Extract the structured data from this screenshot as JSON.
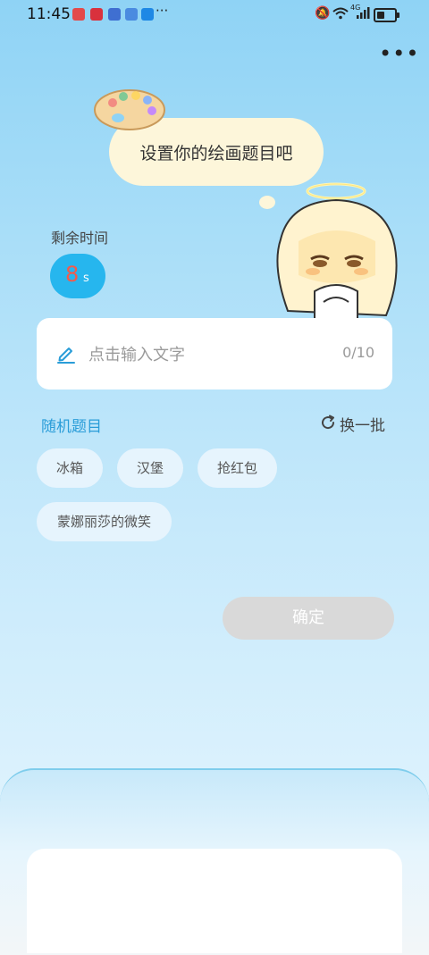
{
  "status_bar": {
    "time": "11:45",
    "overflow": "···",
    "notification_colors": [
      "#e34a4a",
      "#d9313d",
      "#3f6fd1",
      "#4a8be0",
      "#1e88e5"
    ],
    "signal_label": "4G"
  },
  "header": {
    "more_label": "•••"
  },
  "prompt": {
    "bubble_text": "设置你的绘画题目吧"
  },
  "timer": {
    "label": "剩余时间",
    "value": "8",
    "unit": "s"
  },
  "input": {
    "placeholder": "点击输入文字",
    "value": "",
    "count": "0/10"
  },
  "random": {
    "title": "随机题目",
    "refresh_label": "换一批",
    "chips": [
      "冰箱",
      "汉堡",
      "抢红包",
      "蒙娜丽莎的微笑"
    ]
  },
  "confirm": {
    "label": "确定"
  },
  "colors": {
    "accent": "#26b6ee",
    "timer_number": "#f55a4b",
    "section_title": "#2a9dd8",
    "confirm_disabled": "#d9d9d9"
  }
}
